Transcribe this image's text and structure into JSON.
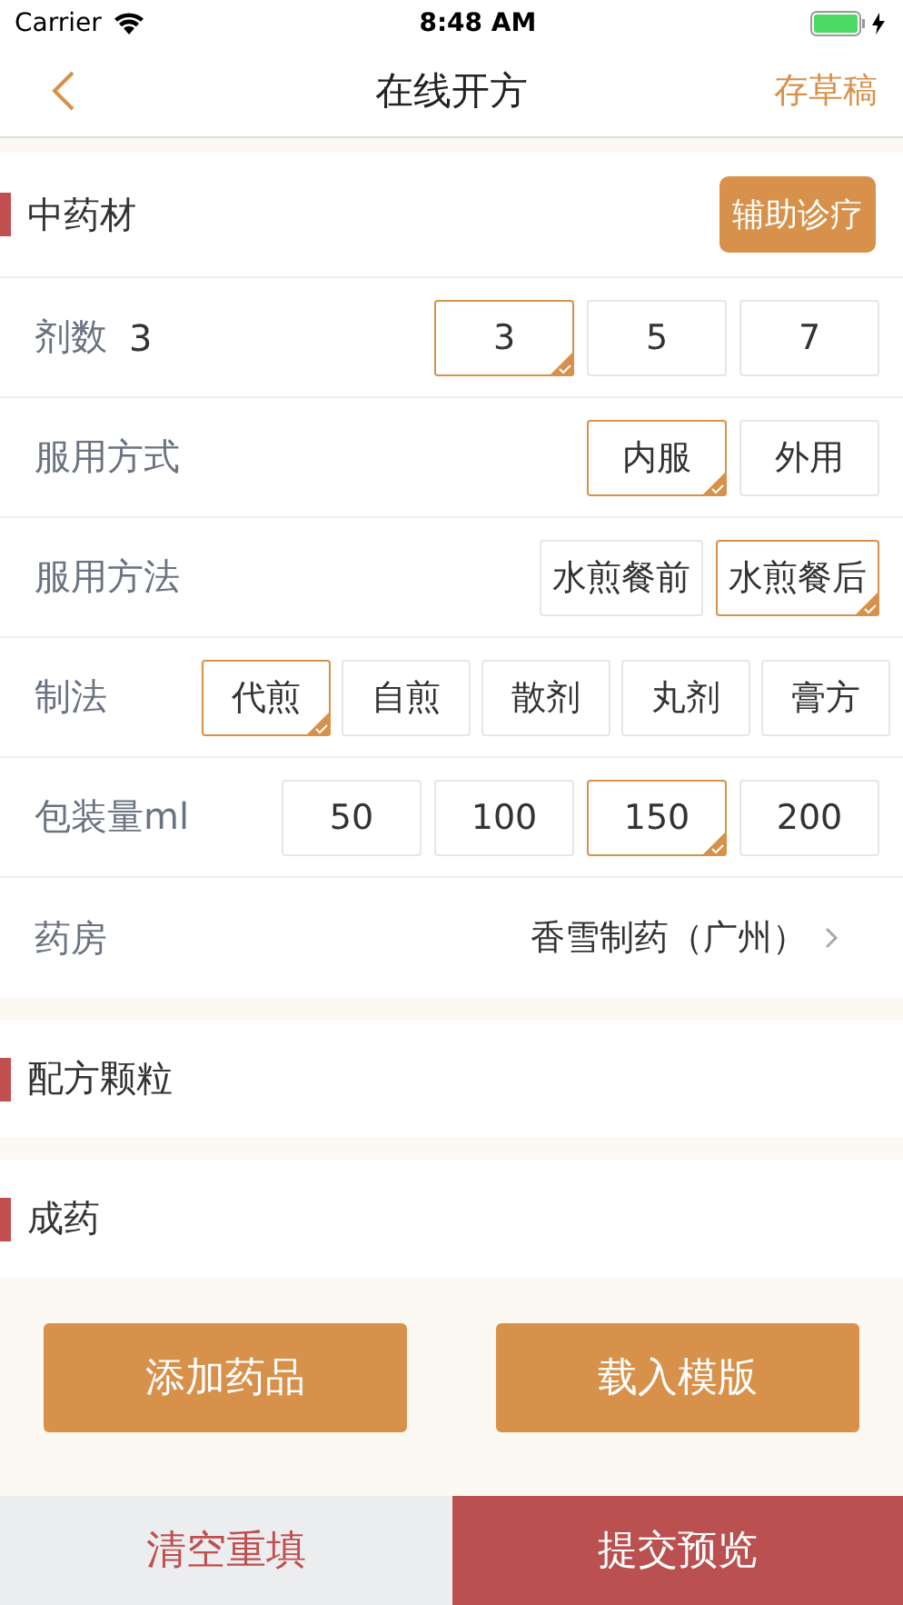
{
  "status_bar": {
    "carrier": "Carrier",
    "time": "8:48 AM"
  },
  "nav": {
    "title": "在线开方",
    "action": "存草稿"
  },
  "herb_section": {
    "title": "中药材",
    "assist_button": "辅助诊疗"
  },
  "rows": [
    {
      "kind": "options",
      "label": "剂数",
      "value": "3",
      "options": [
        {
          "label": "3",
          "selected": true
        },
        {
          "label": "5",
          "selected": false
        },
        {
          "label": "7",
          "selected": false
        }
      ]
    },
    {
      "kind": "options",
      "label": "服用方式",
      "options": [
        {
          "label": "内服",
          "selected": true
        },
        {
          "label": "外用",
          "selected": false
        }
      ]
    },
    {
      "kind": "options",
      "label": "服用方法",
      "options": [
        {
          "label": "水煎餐前",
          "selected": false
        },
        {
          "label": "水煎餐后",
          "selected": true
        }
      ]
    },
    {
      "kind": "options",
      "label": "制法",
      "options": [
        {
          "label": "代煎",
          "selected": true
        },
        {
          "label": "自煎",
          "selected": false
        },
        {
          "label": "散剂",
          "selected": false
        },
        {
          "label": "丸剂",
          "selected": false
        },
        {
          "label": "膏方",
          "selected": false
        }
      ]
    },
    {
      "kind": "options",
      "label": "包装量ml",
      "options": [
        {
          "label": "50",
          "selected": false
        },
        {
          "label": "100",
          "selected": false
        },
        {
          "label": "150",
          "selected": true
        },
        {
          "label": "200",
          "selected": false
        }
      ]
    },
    {
      "kind": "link",
      "label": "药房",
      "value": "香雪制药（广州）"
    }
  ],
  "sections": [
    {
      "title": "配方颗粒"
    },
    {
      "title": "成药"
    }
  ],
  "actions": [
    "添加药品",
    "载入模版"
  ],
  "bottom_bar": {
    "reset": "清空重填",
    "submit": "提交预览"
  }
}
